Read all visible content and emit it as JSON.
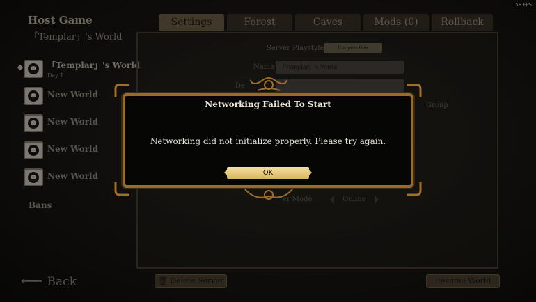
{
  "fps": "58 FPS",
  "sidebar": {
    "title": "Host Game",
    "subtitle": "「Templar」's World",
    "slots": [
      {
        "name": "「Templar」's World",
        "day": "Day 1"
      },
      {
        "name": "New World",
        "day": ""
      },
      {
        "name": "New World",
        "day": ""
      },
      {
        "name": "New World",
        "day": ""
      },
      {
        "name": "New World",
        "day": ""
      }
    ],
    "bans": "Bans",
    "back": "Back"
  },
  "tabs": [
    {
      "label": "Settings"
    },
    {
      "label": "Forest"
    },
    {
      "label": "Caves"
    },
    {
      "label": "Mods (0)"
    },
    {
      "label": "Rollback"
    }
  ],
  "settings": {
    "playstyle_label": "Server Playstyle",
    "playstyle_value": "Cooperative",
    "name_label": "Name",
    "name_value": "「Templar」's World",
    "desc_label": "De",
    "group_label": "Group",
    "mode_label": "er Mode",
    "mode_value": "Online"
  },
  "buttons": {
    "delete": "Delete Server",
    "resume": "Resume World"
  },
  "dialog": {
    "title": "Networking Failed To Start",
    "body": "Networking did not initialize properly. Please try again.",
    "ok": "OK"
  },
  "colors": {
    "dialog_border": "#9a6a2a",
    "ok_button": "#f4dfa0"
  }
}
